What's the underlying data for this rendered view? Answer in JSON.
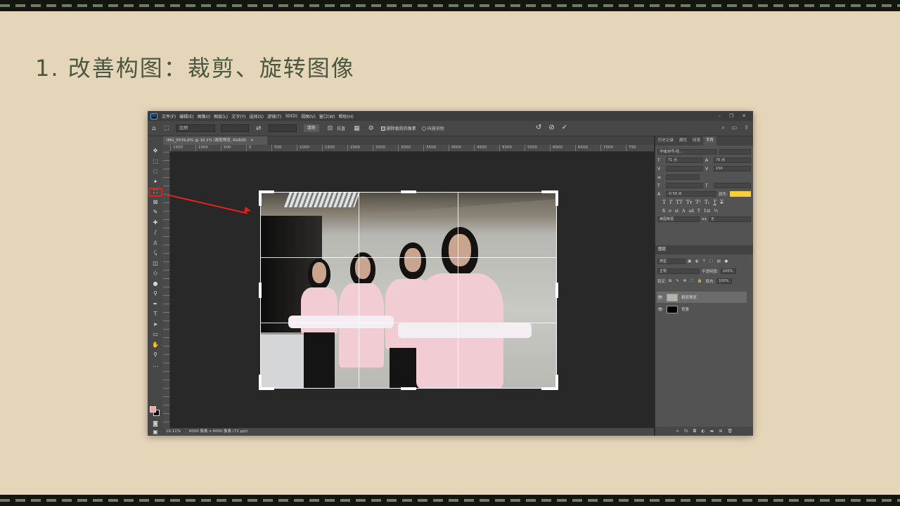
{
  "slide": {
    "title": "1. 改善构图：裁剪、旋转图像"
  },
  "photoshop": {
    "menu": [
      "文件(F)",
      "编辑(E)",
      "图像(I)",
      "图层(L)",
      "文字(Y)",
      "选择(S)",
      "滤镜(T)",
      "3D(D)",
      "视图(V)",
      "窗口(W)",
      "帮助(H)"
    ],
    "options": {
      "ratio_select": "比例",
      "clear_button": "清除",
      "straighten_label": "拉直",
      "delete_cropped_label": "删除裁剪的像素",
      "content_aware_label": "内容识别"
    },
    "doc_tab": "IMG_0539.JPG @ 16.1% (裁剪预览, RGB/8)",
    "ruler_ticks": [
      "1500",
      "1000",
      "500",
      "0",
      "500",
      "1000",
      "1500",
      "2000",
      "2500",
      "3000",
      "3500",
      "4000",
      "4500",
      "5000",
      "5500",
      "6000",
      "6500",
      "7000",
      "750"
    ],
    "status": {
      "zoom": "16.11%",
      "doc_size": "6000 像素 x 4000 像素 (72 ppi)"
    },
    "panels": {
      "tabs": [
        "历史记录",
        "属性",
        "段落",
        "字符"
      ],
      "character": {
        "font": "字魂38号-经...",
        "size": "71 点",
        "leading": "76 点",
        "tracking": "150",
        "baseline": "-0.58 点",
        "color_label": "颜色:",
        "lang": "美国英语",
        "aa": "aa",
        "aa_mode": "无"
      },
      "layers": {
        "title": "图层",
        "kind": "类型",
        "blend": "正常",
        "opacity_label": "不透明度:",
        "opacity": "100%",
        "lock_label": "锁定:",
        "fill_label": "填充:",
        "fill": "100%",
        "items": [
          {
            "name": "裁剪预览",
            "selected": true
          },
          {
            "name": "背景",
            "selected": false
          }
        ]
      }
    }
  },
  "colors": {
    "slide_bg": "#e6d6b9",
    "title": "#4a5741",
    "arrow": "#e0231c",
    "foreground_swatch": "#f2a4a4",
    "text_color_swatch": "#f6cf3a"
  }
}
